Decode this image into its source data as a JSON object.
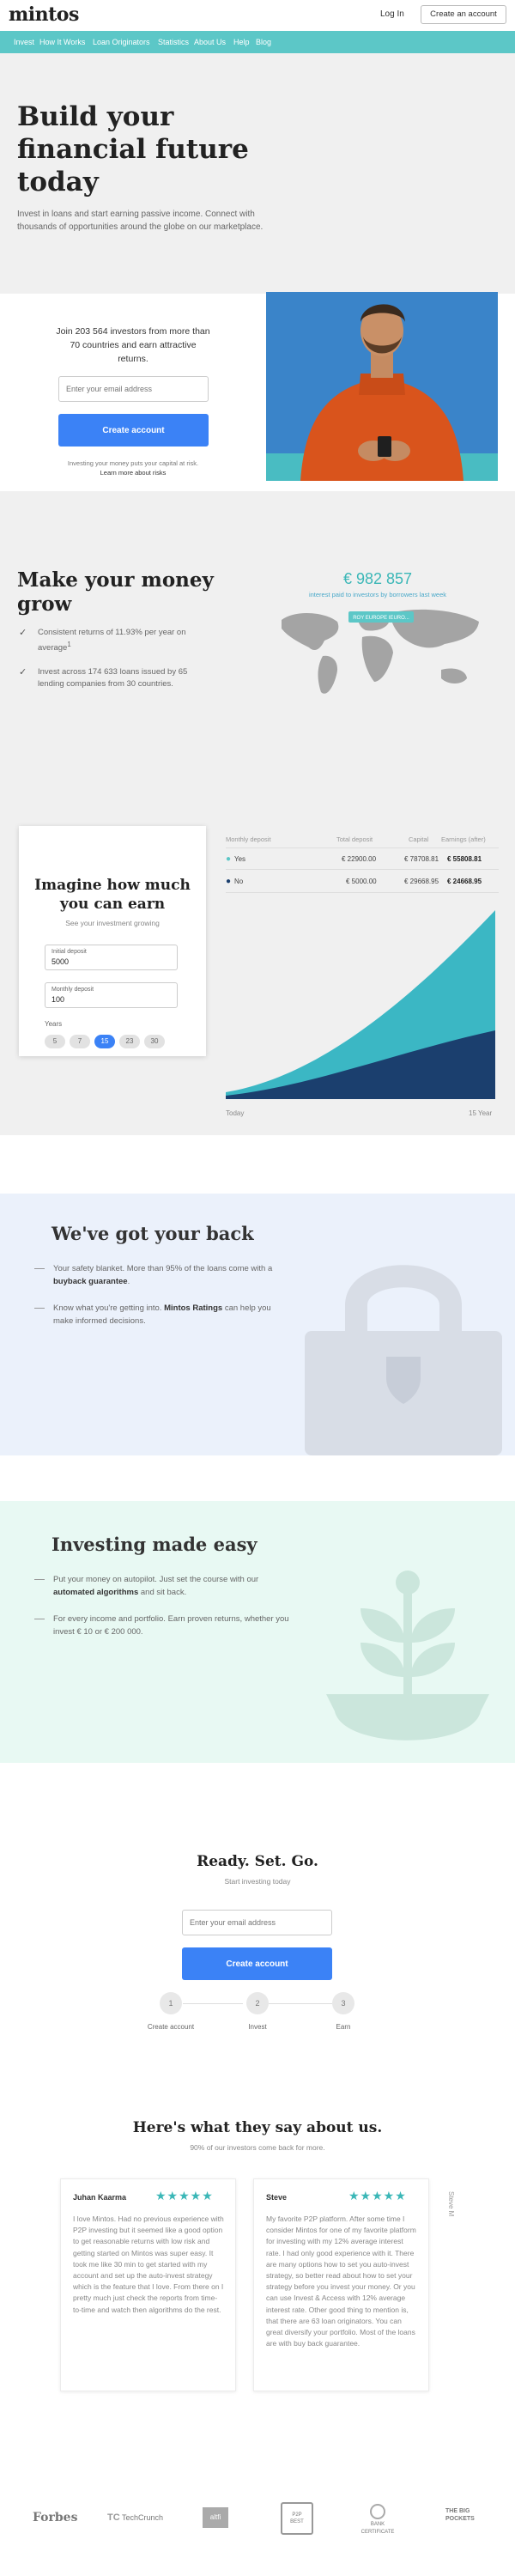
{
  "header": {
    "logo": "mintos",
    "login": "Log In",
    "create_account": "Create an account"
  },
  "nav": {
    "items": [
      "Invest",
      "How It Works",
      "Loan Originators",
      "Statistics",
      "About Us",
      "Help",
      "Blog"
    ]
  },
  "hero": {
    "title": "Build your financial future today",
    "subtitle": "Invest in loans and start earning passive income. Connect with thousands of opportunities around the globe on our marketplace."
  },
  "signup": {
    "join_text": "Join 203 564 investors from more than 70 countries and earn attractive returns.",
    "email_placeholder": "Enter your email address",
    "button": "Create account",
    "risk_line1": "Investing your money puts your capital at risk.",
    "risk_line2": "Learn more about risks"
  },
  "money": {
    "title": "Make your money grow",
    "point1": "Consistent returns of 11.93% per year on average",
    "point1_sup": "1",
    "point2": "Invest across 174 633 loans issued by 65 lending companies from 30 countries.",
    "amount": "€ 982 857",
    "amount_caption": "interest paid to investors by borrowers last week",
    "map_tag": "ROY EUROPE IEURO..."
  },
  "calculator": {
    "title": "Imagine how much you can earn",
    "subtitle": "See your investment growing",
    "initial_label": "Initial deposit",
    "initial_value": "5000",
    "monthly_label": "Monthly deposit",
    "monthly_value": "100",
    "years_label": "Years",
    "years": [
      "5",
      "7",
      "15",
      "23",
      "30"
    ],
    "selected_year": "15",
    "table_headers": [
      "Monthly deposit",
      "Total deposit",
      "Capital",
      "Earnings (after)"
    ],
    "rows": [
      {
        "label": "Yes",
        "total": "€ 22900.00",
        "capital": "€ 78708.81",
        "earnings": "€ 55808.81"
      },
      {
        "label": "No",
        "total": "€ 5000.00",
        "capital": "€ 29668.95",
        "earnings": "€ 24668.95"
      }
    ],
    "x_start": "Today",
    "x_end": "15 Year"
  },
  "back": {
    "title": "We've got your back",
    "p1_a": "Your safety blanket. More than 95% of the loans come with a",
    "p1_b": "buyback guarantee",
    "p1_c": ".",
    "p2_a": "Know what you're getting into.",
    "p2_b": "Mintos Ratings",
    "p2_c": "can help you make informed decisions."
  },
  "easy": {
    "title": "Investing made easy",
    "p1_a": "Put your money on autopilot. Just set the course with our",
    "p1_b": "automated algorithms",
    "p1_c": "and sit back.",
    "p2": "For every income and portfolio. Earn proven returns, whether you invest € 10 or € 200 000."
  },
  "ready": {
    "title": "Ready. Set. Go.",
    "subtitle": "Start investing today",
    "email_placeholder": "Enter your email address",
    "button": "Create account",
    "steps": [
      {
        "num": "1",
        "label": "Create account"
      },
      {
        "num": "2",
        "label": "Invest"
      },
      {
        "num": "3",
        "label": "Earn"
      }
    ]
  },
  "testimonials": {
    "title": "Here's what they say about us.",
    "subtitle": "90% of our investors come back for more.",
    "next": "Steve M",
    "items": [
      {
        "name": "Juhan Kaarma",
        "stars": "★★★★★",
        "text": "I love Mintos. Had no previous experience with P2P investing but it seemed like a good option to get reasonable returns with low risk and getting started on Mintos was super easy. It took me like 30 min to get started with my account and set up the auto-invest strategy which is the feature that I love. From there on I pretty much just check the reports from time-to-time and watch then algorithms do the rest."
      },
      {
        "name": "Steve",
        "stars": "★★★★★",
        "text": "My favorite P2P platform. After some time I consider Mintos for one of my favorite platform for investing with my 12% average interest rate. I had only good experience with it. There are many options how to set you auto-invest strategy, so better read about how to set your strategy before you invest your money. Or you can use Invest & Access with 12% average interest rate. Other good thing to mention is, that there are 63 loan originators. You can great diversify your portfolio. Most of the loans are with buy back guarantee."
      }
    ]
  },
  "press": {
    "logos": [
      "Forbes",
      "TechCrunch",
      "alt fi",
      "P2P BEST PLATFORM",
      "CERTIFICATE BANK",
      "THE BIG POCKETS"
    ],
    "techcrunch_mark": "TC",
    "altfi_mark": "altfi",
    "p2p_line1": "P2P",
    "p2p_line2": "BEST",
    "bank_line1": "BANK",
    "bank_line2": "CERTIFICATE",
    "pockets_line1": "THE BIG",
    "pockets_line2": "POCKETS"
  },
  "colors": {
    "teal": "#5cc7c7",
    "blue": "#3b82f6",
    "navy": "#1b3f6e",
    "light_teal": "#3bb7b7"
  }
}
